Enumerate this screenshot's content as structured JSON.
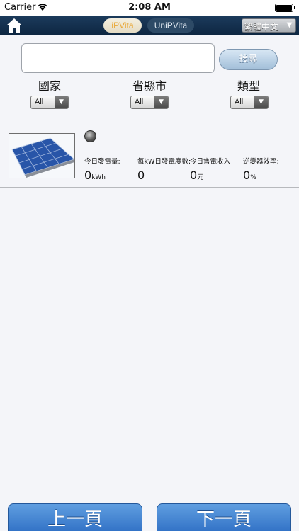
{
  "status_bar": {
    "carrier": "Carrier",
    "time": "2:08 AM"
  },
  "nav": {
    "tabs": [
      {
        "label": "iPVita"
      },
      {
        "label": "UniPVita"
      }
    ],
    "language": "繁體中文"
  },
  "search": {
    "value": "",
    "button_label": "搜尋"
  },
  "filters": [
    {
      "label": "國家",
      "value": "All"
    },
    {
      "label": "省縣市",
      "value": "All"
    },
    {
      "label": "類型",
      "value": "All"
    }
  ],
  "station": {
    "metrics": [
      {
        "label": "今日發電量:",
        "value": "0",
        "unit": "kWh"
      },
      {
        "label": "每kW日發電度數:",
        "value": "0",
        "unit": ""
      },
      {
        "label": "今日售電收入",
        "value": "0",
        "unit": "元"
      },
      {
        "label": "逆變器效率:",
        "value": "0",
        "unit": "%"
      }
    ]
  },
  "pagination": {
    "prev_label": "上一頁",
    "next_label": "下一頁"
  },
  "colors": {
    "nav_bar": "#132f4d",
    "active_tab_text": "#e9a632",
    "button_blue": "#3a7dcf"
  }
}
